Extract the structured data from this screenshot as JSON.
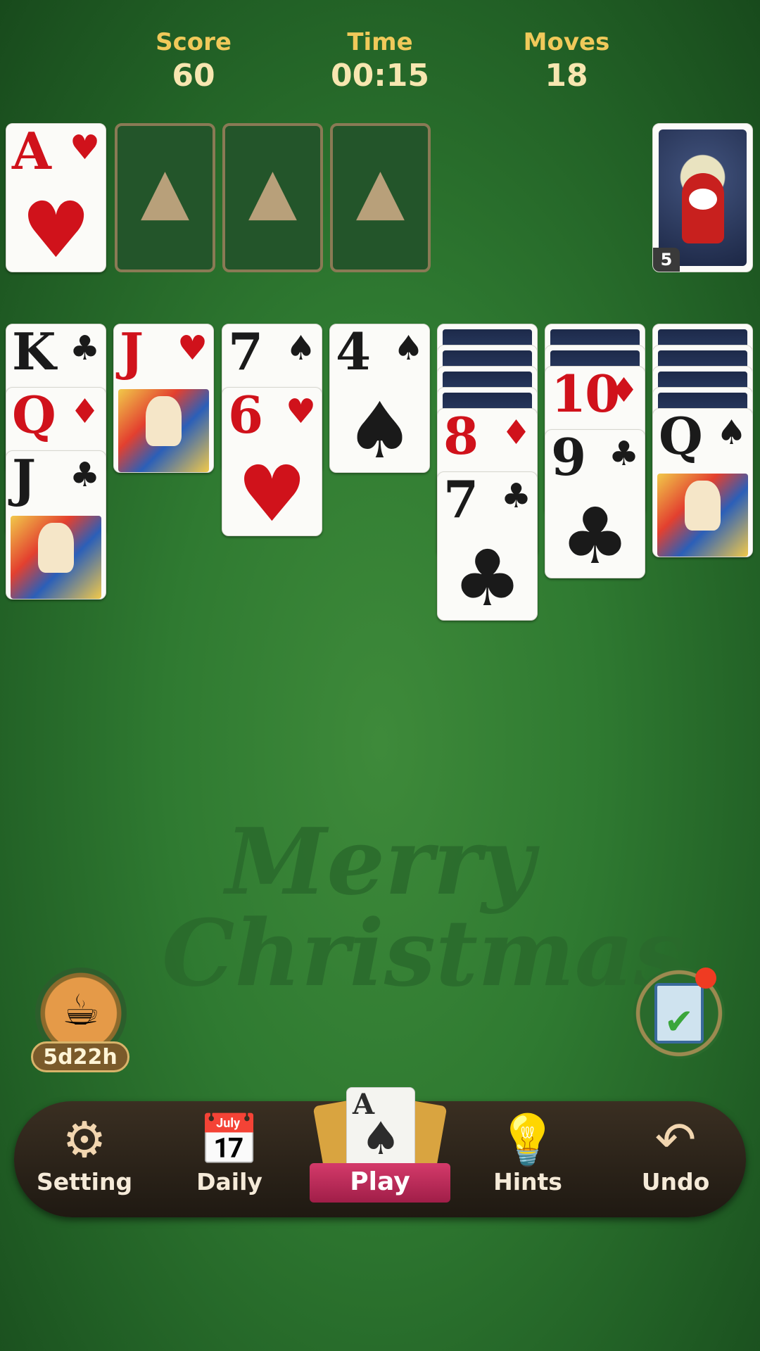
{
  "stats": {
    "score_label": "Score",
    "score": "60",
    "time_label": "Time",
    "time": "00:15",
    "moves_label": "Moves",
    "moves": "18"
  },
  "foundation": [
    {
      "rank": "A",
      "suit": "♥",
      "color": "red"
    },
    {
      "empty": true
    },
    {
      "empty": true
    },
    {
      "empty": true
    }
  ],
  "stock": {
    "count": "5"
  },
  "tableau": [
    {
      "cards": [
        {
          "rank": "K",
          "suit": "♣"
        },
        {
          "rank": "Q",
          "suit": "♦"
        },
        {
          "rank": "J",
          "suit": "♣"
        }
      ]
    },
    {
      "cards": [
        {
          "rank": "J",
          "suit": "♥"
        }
      ]
    },
    {
      "cards": [
        {
          "rank": "7",
          "suit": "♠"
        },
        {
          "rank": "6",
          "suit": "♥"
        }
      ]
    },
    {
      "cards": [
        {
          "rank": "4",
          "suit": "♠"
        }
      ]
    },
    {
      "facedown": 4,
      "cards": [
        {
          "rank": "8",
          "suit": "♦"
        },
        {
          "rank": "7",
          "suit": "♣"
        }
      ]
    },
    {
      "facedown": 2,
      "cards": [
        {
          "rank": "10",
          "suit": "♦"
        },
        {
          "rank": "9",
          "suit": "♣"
        }
      ]
    },
    {
      "facedown": 4,
      "cards": [
        {
          "rank": "Q",
          "suit": "♠"
        }
      ]
    }
  ],
  "watermark": "Merry Christmas",
  "event": {
    "timer": "5d22h"
  },
  "nav": {
    "setting": "Setting",
    "daily": "Daily",
    "play": "Play",
    "hints": "Hints",
    "undo": "Undo",
    "play_card_rank": "A",
    "play_card_suit": "♠"
  },
  "colors": {
    "felt": "#2f7a31",
    "gold": "#f0c95a",
    "red": "#d0121b"
  }
}
